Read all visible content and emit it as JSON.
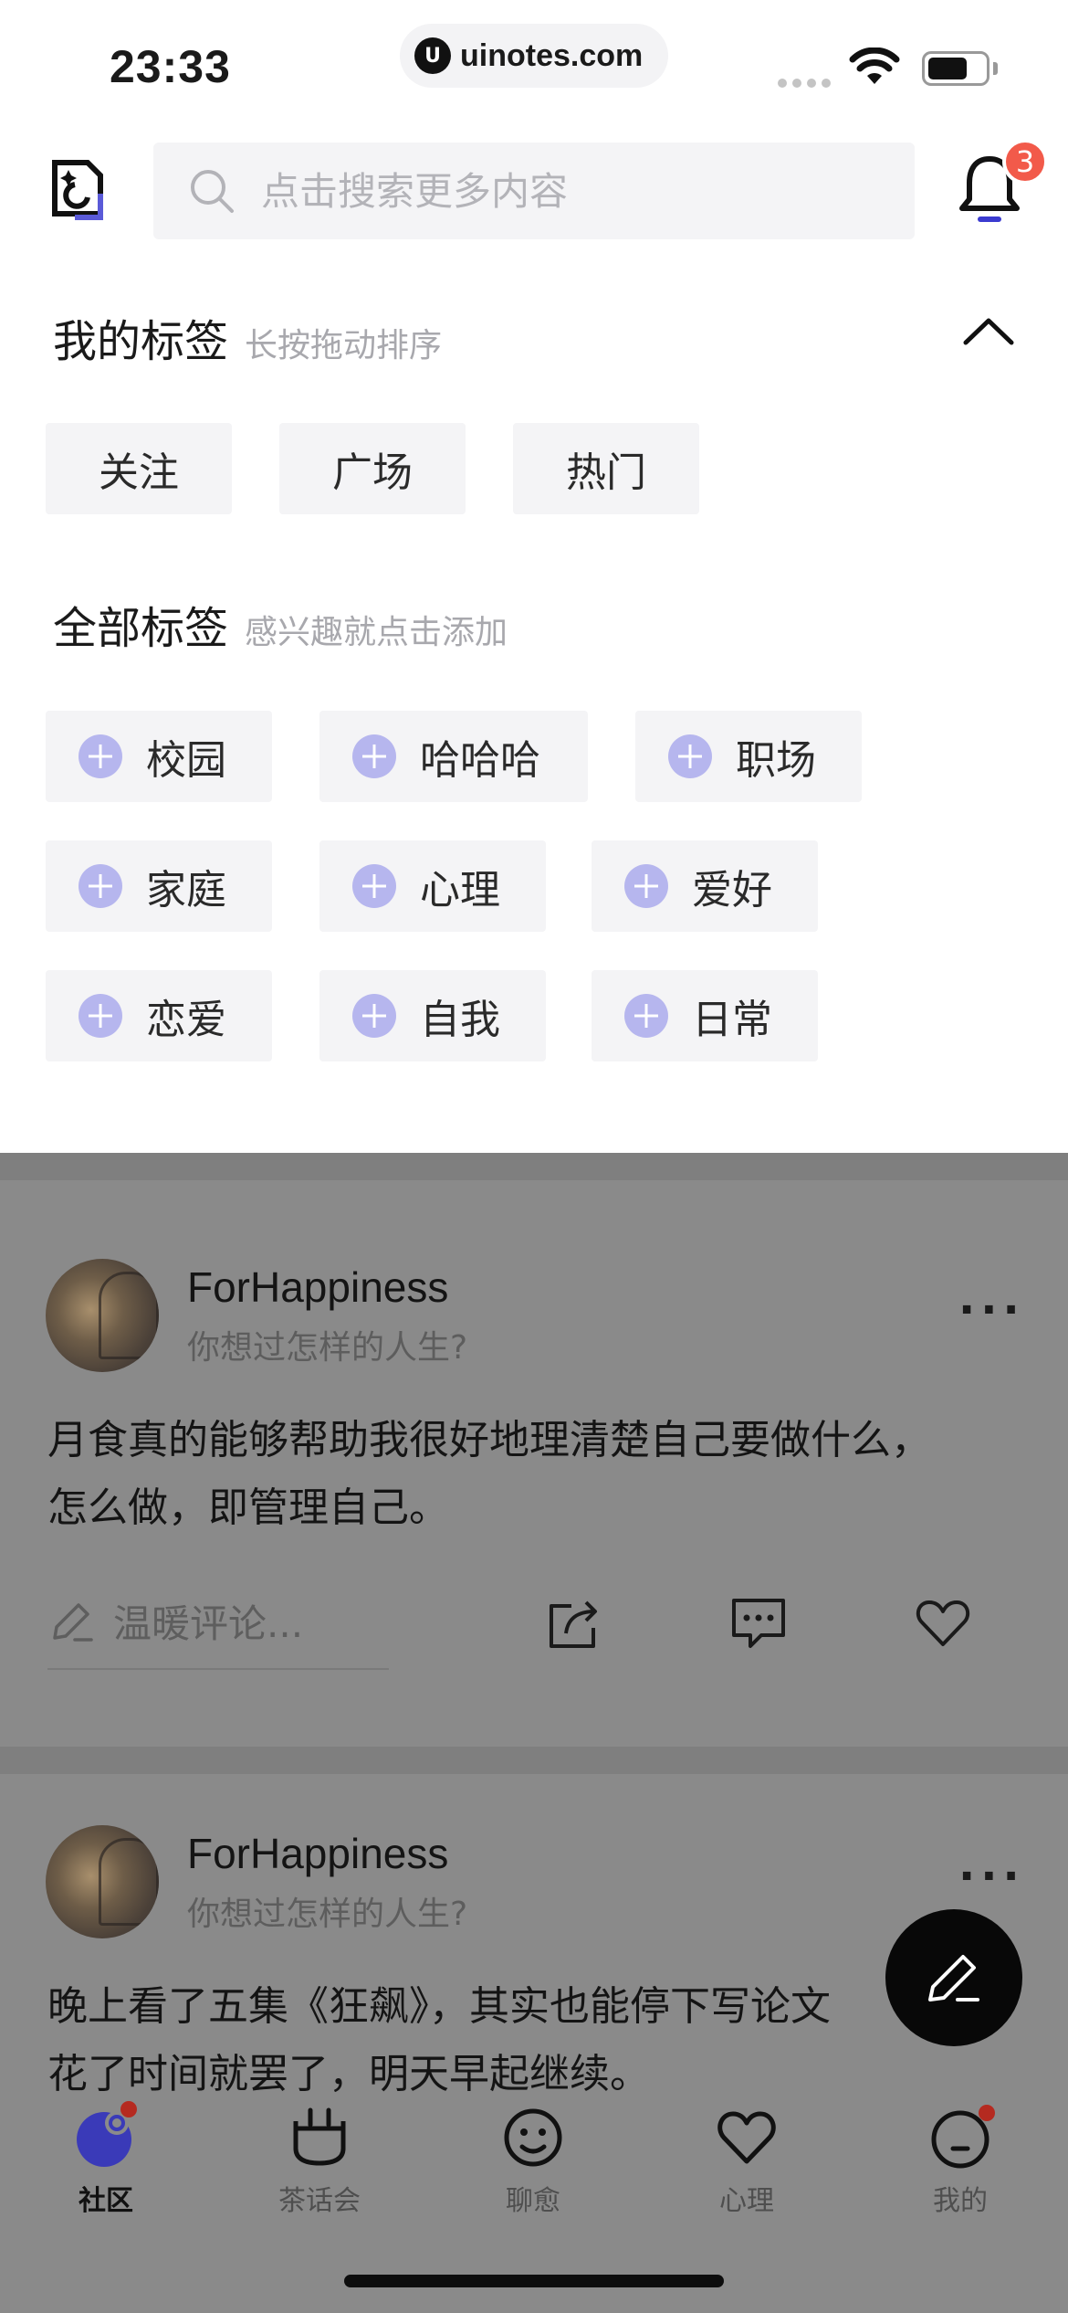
{
  "status_bar": {
    "time": "23:33",
    "url": "uinotes.com"
  },
  "header": {
    "search_placeholder": "点击搜索更多内容",
    "notification_count": "3"
  },
  "my_tags": {
    "title": "我的标签",
    "hint": "长按拖动排序",
    "items": [
      "关注",
      "广场",
      "热门"
    ]
  },
  "all_tags": {
    "title": "全部标签",
    "hint": "感兴趣就点击添加",
    "rows": [
      [
        "校园",
        "哈哈哈",
        "职场"
      ],
      [
        "家庭",
        "心理",
        "爱好"
      ],
      [
        "恋爱",
        "自我",
        "日常"
      ]
    ]
  },
  "feed": {
    "posts": [
      {
        "author": "ForHappiness",
        "tagline": "你想过怎样的人生?",
        "text_line1": "月食真的能够帮助我很好地理清楚自己要做什么，",
        "text_line2": "怎么做，即管理自己。",
        "comment_placeholder": "温暖评论..."
      },
      {
        "author": "ForHappiness",
        "tagline": "你想过怎样的人生?",
        "text_line1": "晚上看了五集《狂飙》，其实也能停下写论文",
        "text_line2": "花了时间就罢了，明天早起继续。"
      }
    ]
  },
  "tabbar": {
    "tabs": [
      {
        "label": "社区",
        "icon": "community-icon",
        "active": true
      },
      {
        "label": "茶话会",
        "icon": "tea-party-icon"
      },
      {
        "label": "聊愈",
        "icon": "chat-face-icon"
      },
      {
        "label": "心理",
        "icon": "heart-icon"
      },
      {
        "label": "我的",
        "icon": "profile-face-icon"
      }
    ]
  },
  "colors": {
    "accent": "#b6b6ee",
    "badge": "#f25a4a",
    "overlay": "#8a8a8a"
  }
}
